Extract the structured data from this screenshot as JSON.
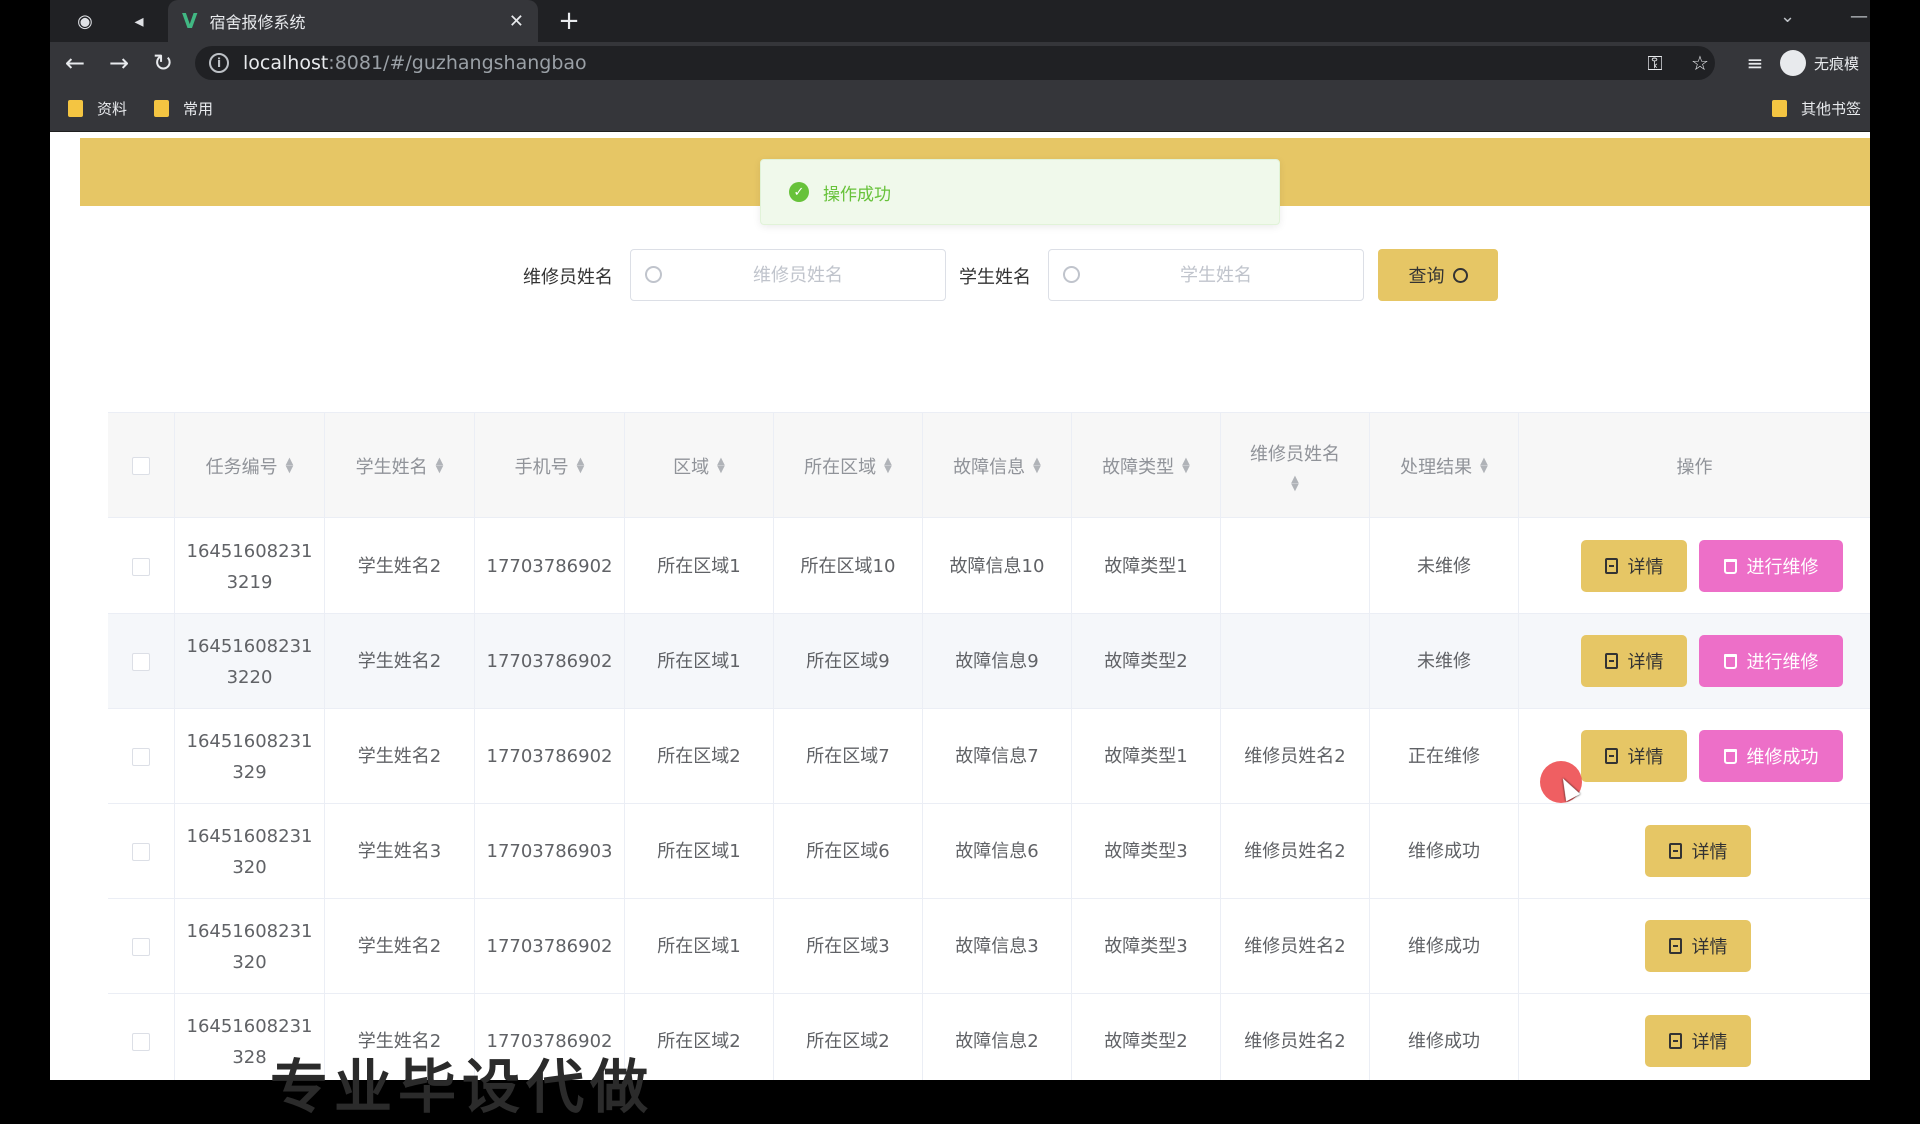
{
  "browser": {
    "tab_title": "宿舍报修系统",
    "url_host": "localhost",
    "url_path": ":8081/#/guzhangshangbao",
    "profile_name": "无痕模",
    "bookmarks": [
      "资料",
      "常用"
    ],
    "other_bookmarks": "其他书签"
  },
  "toast": {
    "message": "操作成功"
  },
  "search": {
    "repairer_label": "维修员姓名",
    "repairer_placeholder": "维修员姓名",
    "student_label": "学生姓名",
    "student_placeholder": "学生姓名",
    "query_label": "查询"
  },
  "table": {
    "headers": {
      "task_no": "任务编号",
      "student": "学生姓名",
      "phone": "手机号",
      "area": "区域",
      "location": "所在区域",
      "fault_info": "故障信息",
      "fault_type": "故障类型",
      "repairer": "维修员姓名",
      "result": "处理结果",
      "ops": "操作"
    },
    "detail_label": "详情",
    "rows": [
      {
        "task_no": "164516082313219",
        "student": "学生姓名2",
        "phone": "17703786902",
        "area": "所在区域1",
        "location": "所在区域10",
        "fault_info": "故障信息10",
        "fault_type": "故障类型1",
        "repairer": "",
        "result": "未维修",
        "action": "进行维修"
      },
      {
        "task_no": "164516082313220",
        "student": "学生姓名2",
        "phone": "17703786902",
        "area": "所在区域1",
        "location": "所在区域9",
        "fault_info": "故障信息9",
        "fault_type": "故障类型2",
        "repairer": "",
        "result": "未维修",
        "action": "进行维修"
      },
      {
        "task_no": "16451608231329",
        "student": "学生姓名2",
        "phone": "17703786902",
        "area": "所在区域2",
        "location": "所在区域7",
        "fault_info": "故障信息7",
        "fault_type": "故障类型1",
        "repairer": "维修员姓名2",
        "result": "正在维修",
        "action": "维修成功"
      },
      {
        "task_no": "16451608231320",
        "student": "学生姓名3",
        "phone": "17703786903",
        "area": "所在区域1",
        "location": "所在区域6",
        "fault_info": "故障信息6",
        "fault_type": "故障类型3",
        "repairer": "维修员姓名2",
        "result": "维修成功",
        "action": ""
      },
      {
        "task_no": "16451608231320",
        "student": "学生姓名2",
        "phone": "17703786902",
        "area": "所在区域1",
        "location": "所在区域3",
        "fault_info": "故障信息3",
        "fault_type": "故障类型3",
        "repairer": "维修员姓名2",
        "result": "维修成功",
        "action": ""
      },
      {
        "task_no": "16451608231328",
        "student": "学生姓名2",
        "phone": "17703786902",
        "area": "所在区域2",
        "location": "所在区域2",
        "fault_info": "故障信息2",
        "fault_type": "故障类型2",
        "repairer": "维修员姓名2",
        "result": "维修成功",
        "action": ""
      }
    ]
  },
  "watermark": "专业毕设代做",
  "colors": {
    "accent": "#e6c665",
    "action_pink": "#ed6fc8",
    "success_green": "#67c23a"
  }
}
